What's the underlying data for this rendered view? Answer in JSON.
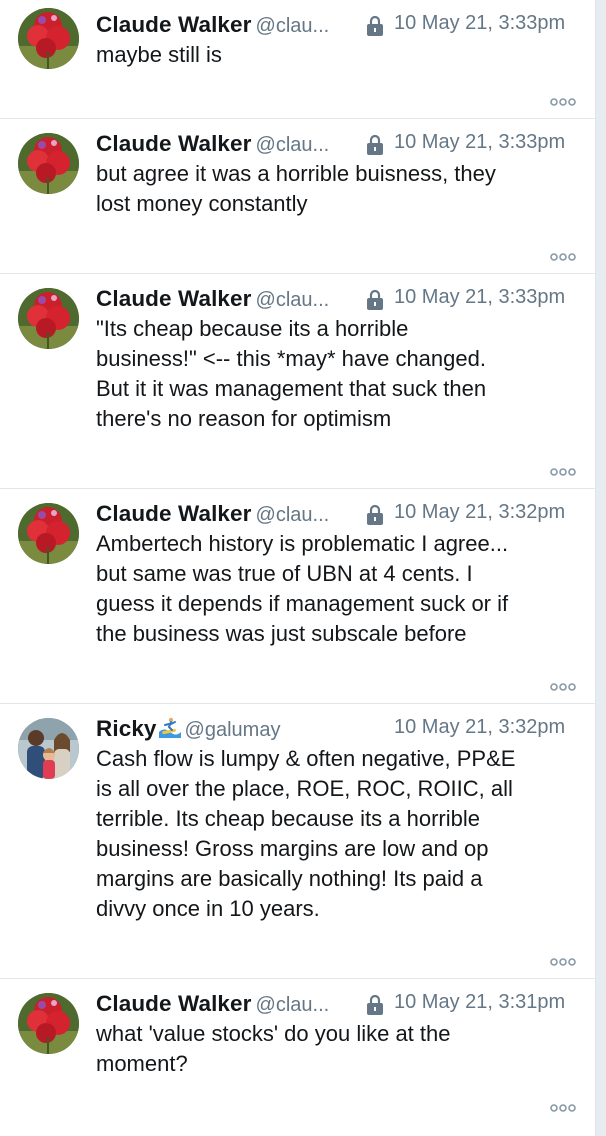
{
  "tweets": [
    {
      "name": "Claude Walker",
      "handle": "@clau...",
      "locked": true,
      "time": "10 May 21, 3:33pm",
      "text": "maybe still is",
      "avatar": "flower-avatar-icon"
    },
    {
      "name": "Claude Walker",
      "handle": "@clau...",
      "locked": true,
      "time": "10 May 21, 3:33pm",
      "text": "but agree it was a horrible buisness, they\nlost money constantly",
      "avatar": "flower-avatar-icon"
    },
    {
      "name": "Claude Walker",
      "handle": "@clau...",
      "locked": true,
      "time": "10 May 21, 3:33pm",
      "text": "\"Its cheap because its a horrible\nbusiness!\" <-- this *may* have changed.\nBut it it was management that suck then\nthere's no reason for optimism",
      "avatar": "flower-avatar-icon"
    },
    {
      "name": "Claude Walker",
      "handle": "@clau...",
      "locked": true,
      "time": "10 May 21, 3:32pm",
      "text": "Ambertech history is problematic I agree...\nbut same was true of UBN at 4 cents. I\nguess it depends if management suck or if\nthe business was just subscale before",
      "avatar": "flower-avatar-icon"
    },
    {
      "name": "Ricky",
      "handle": "@galumay",
      "locked": false,
      "time": "10 May 21, 3:32pm",
      "text": "Cash flow is lumpy & often negative, PP&E\nis all over the place, ROE, ROC, ROIIC, all\nterrible. Its cheap because its a horrible\nbusiness! Gross margins are low and op\nmargins are basically nothing! Its paid a\ndivvy once in 10 years.",
      "avatar": "family-avatar-icon"
    },
    {
      "name": "Claude Walker",
      "handle": "@clau...",
      "locked": true,
      "time": "10 May 21, 3:31pm",
      "text": "what 'value stocks' do you like at the\nmoment?",
      "avatar": "flower-avatar-icon"
    }
  ],
  "icons": {
    "lock": "lock-icon",
    "more": "more-options-icon",
    "name_emoji": "surfer-emoji-icon"
  },
  "colors": {
    "name": "#14171a",
    "meta": "#657786",
    "divider": "#e1e8ed"
  }
}
